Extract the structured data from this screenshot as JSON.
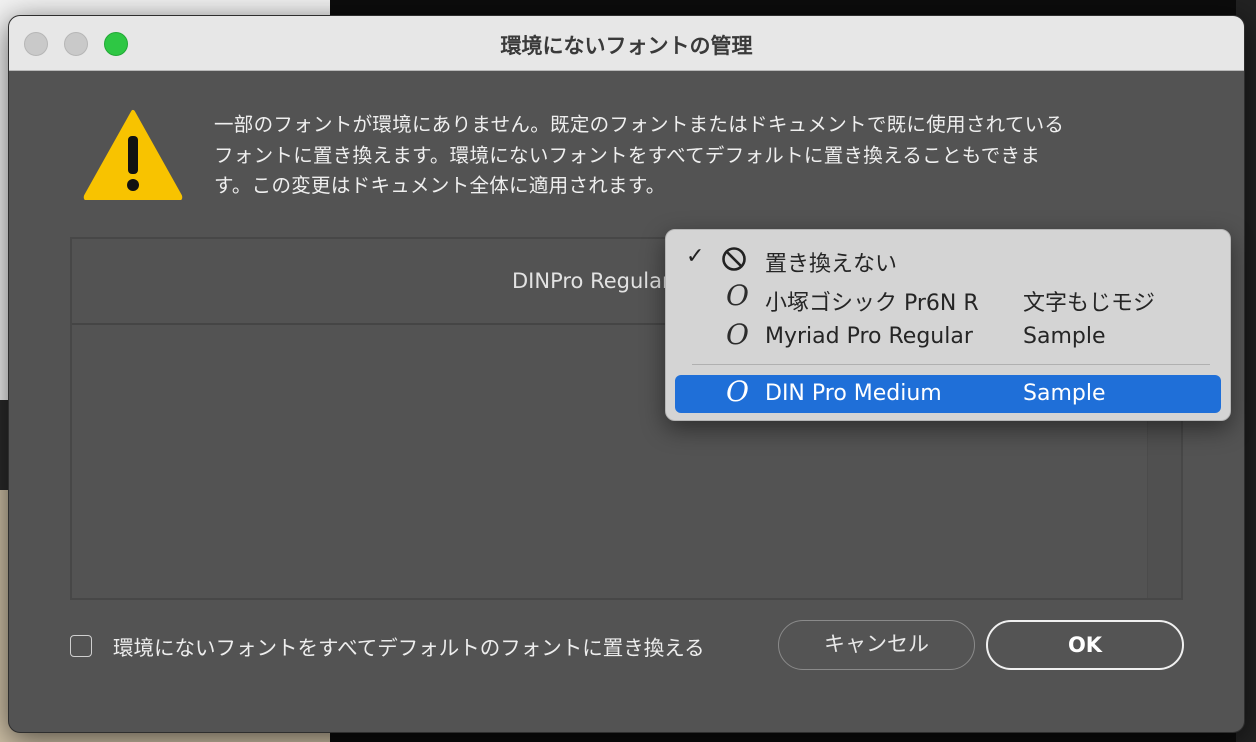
{
  "window": {
    "title": "環境にないフォントの管理"
  },
  "icons": {
    "warning": "warning-icon",
    "no_replace": "prohibited-icon",
    "font_type": "opentype-font-icon",
    "check": "checkmark-icon"
  },
  "colors": {
    "warning_yellow": "#f8c300",
    "selection_blue": "#1f6fd8",
    "zoom_green": "#2ec744"
  },
  "message": {
    "line1": "一部のフォントが環境にありません。既定のフォントまたはドキュメントで既に使用されている",
    "line2": "フォントに置き換えます。環境にないフォントをすべてデフォルトに置き換えることもできま",
    "line3": "す。この変更はドキュメント全体に適用されます。"
  },
  "table": {
    "missing_font_column": "DINPro Regular"
  },
  "dropdown": {
    "items": [
      {
        "label": "置き換えない",
        "checked": true,
        "icon": "prohibited-icon"
      },
      {
        "label": "小塚ゴシック Pr6N R",
        "sample": "文字もじモジ",
        "icon": "opentype-font-icon"
      },
      {
        "label": "Myriad Pro Regular",
        "sample": "Sample",
        "icon": "opentype-font-icon"
      },
      {
        "label": "DIN Pro Medium",
        "sample": "Sample",
        "icon": "opentype-font-icon",
        "highlighted": true
      }
    ],
    "glyph": "O",
    "check_mark": "✓"
  },
  "footer": {
    "replace_all_label": "環境にないフォントをすべてデフォルトのフォントに置き換える",
    "replace_all_checked": false,
    "cancel_label": "キャンセル",
    "ok_label": "OK"
  }
}
